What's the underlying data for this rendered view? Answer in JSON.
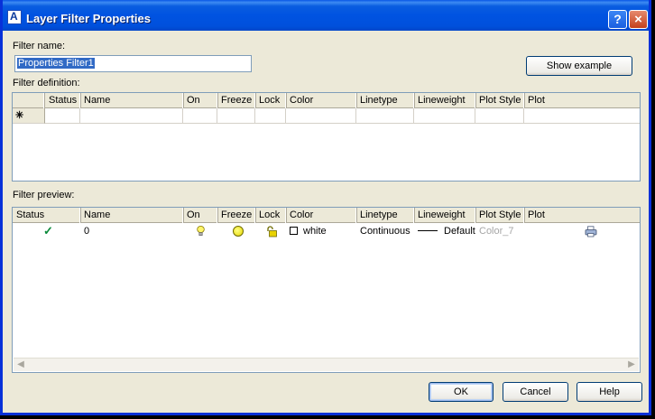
{
  "window": {
    "title": "Layer Filter Properties",
    "help_label": "?",
    "close_label": "×"
  },
  "filter_name": {
    "label": "Filter name:",
    "value": "Properties Filter1"
  },
  "show_example_label": "Show example",
  "filter_definition": {
    "label": "Filter definition:",
    "columns": [
      "Status",
      "Name",
      "On",
      "Freeze",
      "Lock",
      "Color",
      "Linetype",
      "Lineweight",
      "Plot Style",
      "Plot"
    ],
    "new_row_marker": "✳"
  },
  "filter_preview": {
    "label": "Filter preview:",
    "columns": [
      "Status",
      "Name",
      "On",
      "Freeze",
      "Lock",
      "Color",
      "Linetype",
      "Lineweight",
      "Plot Style",
      "Plot"
    ],
    "rows": [
      {
        "status": "✓",
        "name": "0",
        "on": "lightbulb-on-icon",
        "freeze": "sun-thawed-icon",
        "lock": "unlocked-icon",
        "color": "white",
        "linetype": "Continuous",
        "lineweight": "Default",
        "plot_style": "Color_7",
        "plot": "printer-icon"
      }
    ]
  },
  "buttons": {
    "ok": "OK",
    "cancel": "Cancel",
    "help": "Help"
  },
  "colors": {
    "titlebar": "#0054E3",
    "dialog_bg": "#ECE9D8",
    "selection": "#316AC5",
    "status_check": "#0A8A3A",
    "plot_style_disabled": "#A6A6A6"
  }
}
